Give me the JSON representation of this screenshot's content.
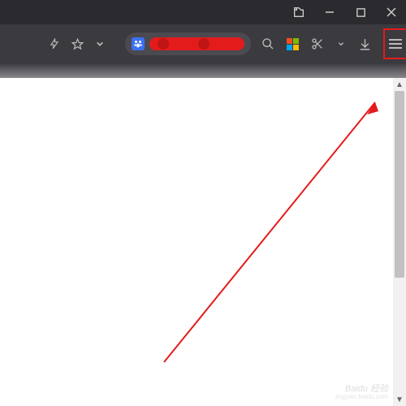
{
  "titlebar": {
    "appearance_icon": "appearance",
    "minimize": "minimize",
    "maximize": "maximize",
    "close": "close"
  },
  "toolbar": {
    "flash_icon": "flash",
    "favorite_icon": "favorite",
    "dropdown_icon": "chevron-down",
    "urlbar": {
      "favicon": "baidu-paw"
    },
    "search_icon": "search",
    "colors_icon": "microsoft-colors",
    "screenshot_icon": "scissors",
    "download_icon": "download",
    "menu_icon": "hamburger"
  },
  "annotation": {
    "color": "#e41b1b"
  },
  "watermark": {
    "main": "Baidu 经验",
    "sub": "jingyan.baidu.com"
  }
}
